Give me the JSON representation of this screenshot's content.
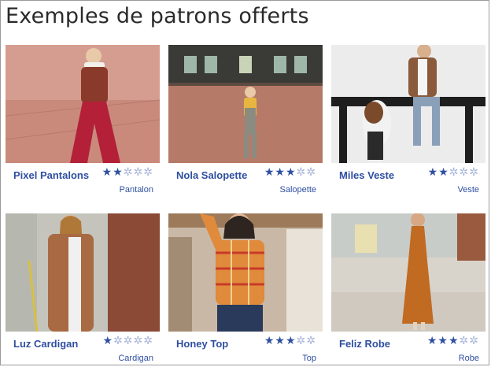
{
  "page": {
    "title": "Exemples de patrons offerts"
  },
  "colors": {
    "accent": "#2f4fa0",
    "star_empty": "#a8b6da",
    "border": "#9a9a9a"
  },
  "patterns": [
    {
      "name": "Pixel Pantalons",
      "category": "Pantalon",
      "rating": 2,
      "rating_max": 5
    },
    {
      "name": "Nola Salopette",
      "category": "Salopette",
      "rating": 3,
      "rating_max": 5
    },
    {
      "name": "Miles Veste",
      "category": "Veste",
      "rating": 2,
      "rating_max": 5
    },
    {
      "name": "Luz Cardigan",
      "category": "Cardigan",
      "rating": 1,
      "rating_max": 5
    },
    {
      "name": "Honey Top",
      "category": "Top",
      "rating": 3,
      "rating_max": 5
    },
    {
      "name": "Feliz Robe",
      "category": "Robe",
      "rating": 3,
      "rating_max": 5
    }
  ]
}
